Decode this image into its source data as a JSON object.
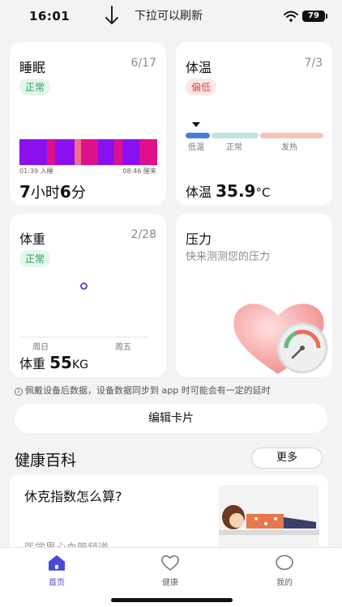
{
  "status_bar": {
    "time": "16:01",
    "pull_hint": "下拉可以刷新",
    "battery": "79"
  },
  "sleep_card": {
    "title": "睡眠",
    "date": "6/17",
    "badge": "正常",
    "start_label": "01:39 入睡",
    "end_label": "08:46 醒来",
    "hours": "7",
    "hours_unit": "小时",
    "minutes": "6",
    "minutes_unit": "分",
    "segments": [
      {
        "color": "#8b10f0",
        "width": 0.2
      },
      {
        "color": "#e0108a",
        "width": 0.06
      },
      {
        "color": "#8b10f0",
        "width": 0.14
      },
      {
        "color": "#f26a8c",
        "width": 0.05
      },
      {
        "color": "#e0108a",
        "width": 0.12
      },
      {
        "color": "#8b10f0",
        "width": 0.12
      },
      {
        "color": "#e0108a",
        "width": 0.06
      },
      {
        "color": "#8b10f0",
        "width": 0.08
      },
      {
        "color": "#8b10f0",
        "width": 0.04
      },
      {
        "color": "#e0108a",
        "width": 0.13
      }
    ]
  },
  "temp_card": {
    "title": "体温",
    "date": "7/3",
    "badge": "偏低",
    "label_low": "低温",
    "label_normal": "正常",
    "label_fever": "发热",
    "value_prefix": "体温",
    "value": "35.9",
    "unit": "°C",
    "color_low": "#4a7de0",
    "color_normal": "#bfe6d4",
    "color_fever": "#f6c4b6"
  },
  "weight_card": {
    "title": "体重",
    "date": "2/28",
    "badge": "正常",
    "tick_left": "周日",
    "tick_right": "周五",
    "value_prefix": "体重",
    "value": "55",
    "unit": "KG"
  },
  "stress_card": {
    "title": "压力",
    "subtitle": "快来测测您的压力"
  },
  "notice": "佩戴设备后数据，设备数据同步到 app 时可能会有一定的延时",
  "edit_button": "编辑卡片",
  "health": {
    "section_title": "健康百科",
    "more": "更多",
    "article_title": "休克指数怎么算?",
    "article_source": "医学界心血管频道"
  },
  "tabs": [
    {
      "label": "首页",
      "icon": "home-icon"
    },
    {
      "label": "健康",
      "icon": "heart-icon"
    },
    {
      "label": "我的",
      "icon": "profile-icon"
    }
  ],
  "colors": {
    "accent": "#4a49d8",
    "normal_green": "#27a35a",
    "low_red": "#e24848"
  }
}
